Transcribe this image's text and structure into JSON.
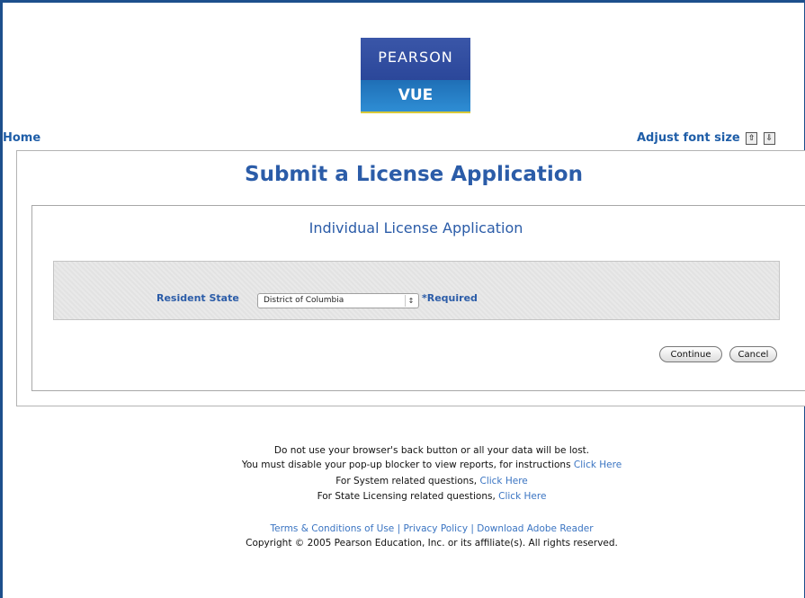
{
  "brand": {
    "logo_top": "PEARSON",
    "logo_bottom": "VUE"
  },
  "nav": {
    "home": "Home",
    "adjust_font_size": "Adjust font size",
    "font_increase_icon": "⇧",
    "font_decrease_icon": "⇩"
  },
  "page": {
    "title": "Submit a License Application",
    "section_title": "Individual License Application"
  },
  "form": {
    "resident_state_label": "Resident State",
    "resident_state_value": "District of Columbia",
    "required_note": "*Required",
    "select_arrows": "↕"
  },
  "buttons": {
    "continue": "Continue",
    "cancel": "Cancel"
  },
  "footer": {
    "line1": "Do not use your browser's back button or all your data will be lost.",
    "line2_text": "You must disable your pop-up blocker to view reports, for instructions ",
    "line2_link": "Click Here",
    "line3_text": "For System related questions, ",
    "line3_link": "Click Here",
    "line4_text": "For State Licensing related questions, ",
    "line4_link": "Click Here",
    "terms": "Terms & Conditions of Use",
    "separator": " | ",
    "privacy": "Privacy Policy",
    "adobe": "Download Adobe Reader",
    "copyright": "Copyright © 2005 Pearson Education, Inc. or its affiliate(s). All rights reserved."
  },
  "colors": {
    "frame_border": "#1d4f8c",
    "heading_blue": "#2b5ca8",
    "link_blue": "#3a74c2",
    "logo_blue": "#2f4da0"
  }
}
